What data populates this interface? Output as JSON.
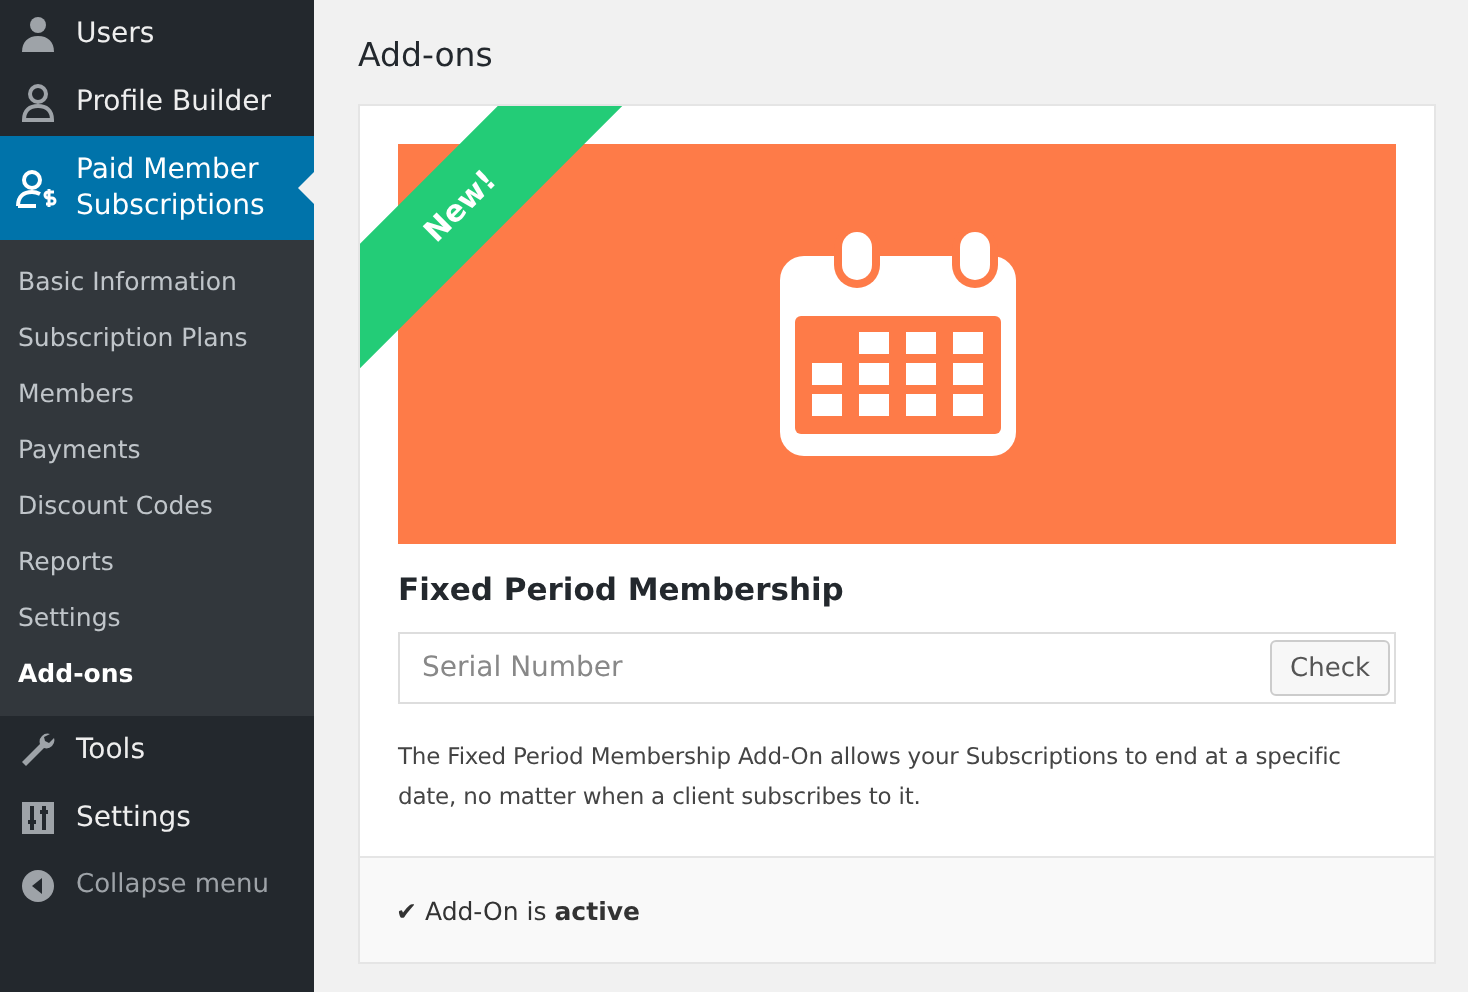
{
  "sidebar": {
    "items": [
      {
        "label": "Users",
        "kind": "link",
        "selected": false
      },
      {
        "label": "Profile Builder",
        "kind": "link",
        "selected": false
      },
      {
        "label": "Paid Member Subscriptions",
        "kind": "link",
        "selected": true,
        "children": [
          {
            "label": "Basic Information",
            "selected": false
          },
          {
            "label": "Subscription Plans",
            "selected": false
          },
          {
            "label": "Members",
            "selected": false
          },
          {
            "label": "Payments",
            "selected": false
          },
          {
            "label": "Discount Codes",
            "selected": false
          },
          {
            "label": "Reports",
            "selected": false
          },
          {
            "label": "Settings",
            "selected": false
          },
          {
            "label": "Add-ons",
            "selected": true
          }
        ]
      },
      {
        "label": "Tools",
        "kind": "link",
        "selected": false
      },
      {
        "label": "Settings",
        "kind": "link",
        "selected": false
      },
      {
        "label": "Collapse menu",
        "kind": "collapse",
        "selected": false
      }
    ]
  },
  "page": {
    "title": "Add-ons"
  },
  "addon": {
    "ribbon": "New!",
    "title": "Fixed Period Membership",
    "serial": {
      "placeholder": "Serial Number"
    },
    "button": "Check",
    "description": "The Fixed Period Membership Add-On allows your Subscriptions to end at a specific date, no matter when a client subscribes to it.",
    "status": {
      "mark": "✔",
      "text": "Add-On is **active**"
    }
  }
}
